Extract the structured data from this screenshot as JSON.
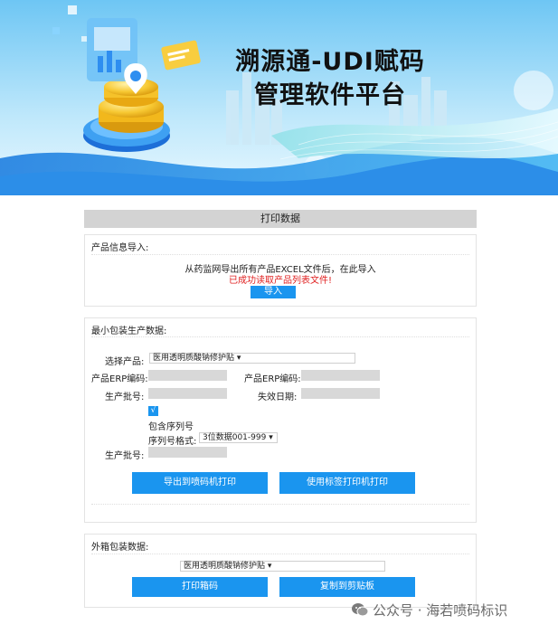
{
  "banner": {
    "title_line1": "溯源通-UDI赋码",
    "title_line2": "管理软件平台"
  },
  "page_title": "打印数据",
  "import_section": {
    "heading": "产品信息导入:",
    "instruction": "从药监网导出所有产品EXCEL文件后，在此导入",
    "status": "已成功读取产品列表文件!",
    "import_button": "导入",
    "status_color": "#e02020"
  },
  "min_pack_section": {
    "heading": "最小包装生产数据:",
    "select_product_label": "选择产品:",
    "product_value": "医用透明质酸钠修护贴",
    "erp_label_left": "产品ERP编码:",
    "erp_label_right": "产品ERP编码:",
    "batch_label": "生产批号:",
    "expiry_label": "失效日期:",
    "checkbox_mark": "√",
    "include_serial_label": "包含序列号",
    "serial_format_label": "序列号格式:",
    "serial_format_value": "3位数据001-999",
    "batch_label_2": "生产批号:",
    "export_button": "导出到喷码机打印",
    "label_print_button": "使用标签打印机打印"
  },
  "outer_box_section": {
    "heading": "外箱包装数据:",
    "product_value": "医用透明质酸钠修护贴",
    "print_box_button": "打印箱码",
    "copy_button": "复制到剪贴板"
  },
  "watermark": "公众号 · 海若喷码标识",
  "colors": {
    "accent": "#1a95ef",
    "header_bar": "#d3d3d3",
    "field": "#d8d8d8"
  }
}
